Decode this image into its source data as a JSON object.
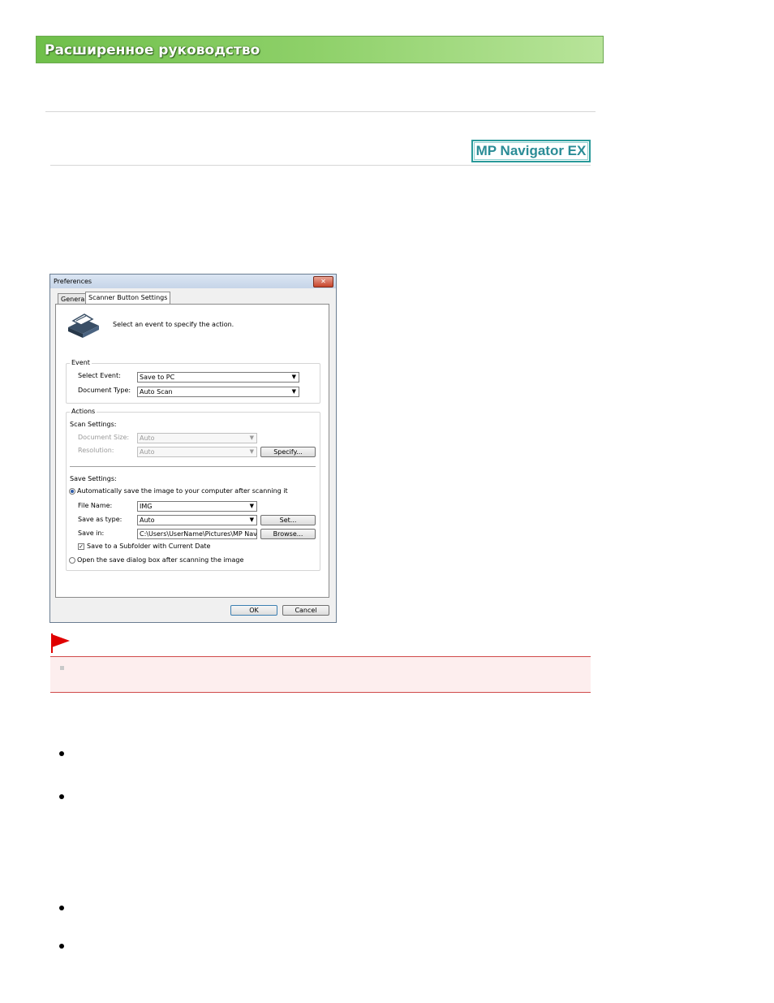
{
  "header": {
    "title": "Расширенное руководство"
  },
  "badge": {
    "label": "MP Navigator EX"
  },
  "dialog": {
    "title": "Preferences",
    "close_label": "✕",
    "tabs": [
      "General",
      "Scanner Button Settings"
    ],
    "instruction": "Select an event to specify the action.",
    "event_group": {
      "title": "Event",
      "select_event_label": "Select Event:",
      "select_event_value": "Save to PC",
      "document_type_label": "Document Type:",
      "document_type_value": "Auto Scan"
    },
    "actions_group": {
      "title": "Actions",
      "scan_settings_label": "Scan Settings:",
      "document_size_label": "Document Size:",
      "document_size_value": "Auto",
      "resolution_label": "Resolution:",
      "resolution_value": "Auto",
      "specify_button": "Specify...",
      "save_settings_label": "Save Settings:",
      "auto_save_label": "Automatically save the image to your computer after scanning it",
      "file_name_label": "File Name:",
      "file_name_value": "IMG",
      "save_as_type_label": "Save as type:",
      "save_as_type_value": "Auto",
      "set_button": "Set...",
      "save_in_label": "Save in:",
      "save_in_value": "C:\\Users\\UserName\\Pictures\\MP Navigatc",
      "browse_button": "Browse...",
      "subfolder_label": "Save to a Subfolder with Current Date",
      "open_dialog_label": "Open the save dialog box after scanning the image"
    },
    "ok_button": "OK",
    "cancel_button": "Cancel"
  },
  "icons": {
    "flag": "flag-icon",
    "scanner": "scanner-icon"
  },
  "colors": {
    "banner": "#8fd16a",
    "badge": "#2a8c96",
    "note_bg": "#fdeeee",
    "note_border": "#d04a4a",
    "flag": "#e00000"
  }
}
